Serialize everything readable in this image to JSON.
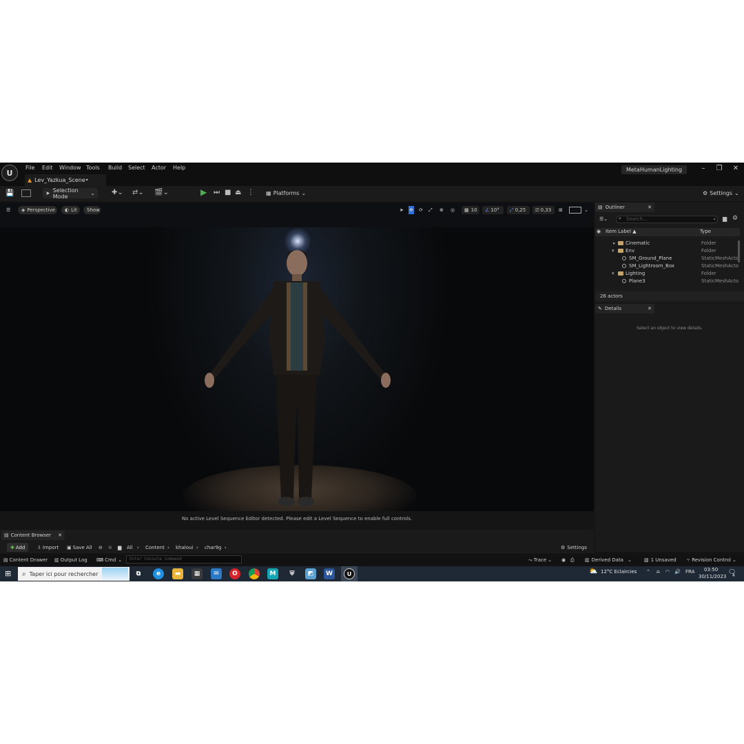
{
  "menu": [
    "File",
    "Edit",
    "Window",
    "Tools",
    "Build",
    "Select",
    "Actor",
    "Help"
  ],
  "level_tab": "Lev_Yazkua_Scene•",
  "project_name": "MetaHumanLighting",
  "window_controls": {
    "minimize": "–",
    "maximize": "❐",
    "close": "✕"
  },
  "toolbar": {
    "selection_mode": "Selection Mode",
    "platforms": "Platforms",
    "settings": "Settings"
  },
  "viewport": {
    "perspective": "Perspective",
    "lit": "Lit",
    "show": "Show",
    "grid_snap": "10",
    "rotation_snap": "10°",
    "scale_snap": "0,25",
    "camera_speed": "0,33",
    "message": "No active Level Sequence Editor detected. Please edit a Level Sequence to enable full controls."
  },
  "outliner": {
    "tab": "Outliner",
    "search_placeholder": "Search...",
    "col_label": "Item Label ▲",
    "col_type": "Type",
    "rows": [
      {
        "label": "Cinematic",
        "type": "Folder",
        "kind": "folder"
      },
      {
        "label": "Env",
        "type": "Folder",
        "kind": "folder"
      },
      {
        "label": "SM_Ground_Plane",
        "type": "StaticMeshActo",
        "kind": "mesh"
      },
      {
        "label": "SM_Lightroom_Box",
        "type": "StaticMeshActo",
        "kind": "mesh"
      },
      {
        "label": "Lighting",
        "type": "Folder",
        "kind": "folder"
      },
      {
        "label": "Plane3",
        "type": "StaticMeshActo",
        "kind": "mesh"
      }
    ],
    "actor_count": "26 actors"
  },
  "details": {
    "tab": "Details",
    "empty_message": "Select an object to view details."
  },
  "content_browser": {
    "tab": "Content Browser",
    "add": "Add",
    "import": "Import",
    "save_all": "Save All",
    "path": [
      "All",
      "Content",
      "khaloui",
      "char9g"
    ],
    "settings": "Settings"
  },
  "status_bar": {
    "content_drawer": "Content Drawer",
    "output_log": "Output Log",
    "cmd": "Cmd",
    "console_placeholder": "Enter Console Command",
    "trace": "Trace",
    "derived_data": "Derived Data",
    "unsaved": "1 Unsaved",
    "revision_control": "Revision Control"
  },
  "taskbar": {
    "search_placeholder": "Taper ici pour rechercher",
    "weather": "12°C  Eclaircies",
    "language": "FRA",
    "time": "03:50",
    "date": "30/11/2023",
    "notifications": "4"
  },
  "colors": {
    "editor_bg": "#151515",
    "play_green": "#4caf50",
    "folder": "#c4a46a",
    "snap_blue": "#2f6fd6"
  }
}
